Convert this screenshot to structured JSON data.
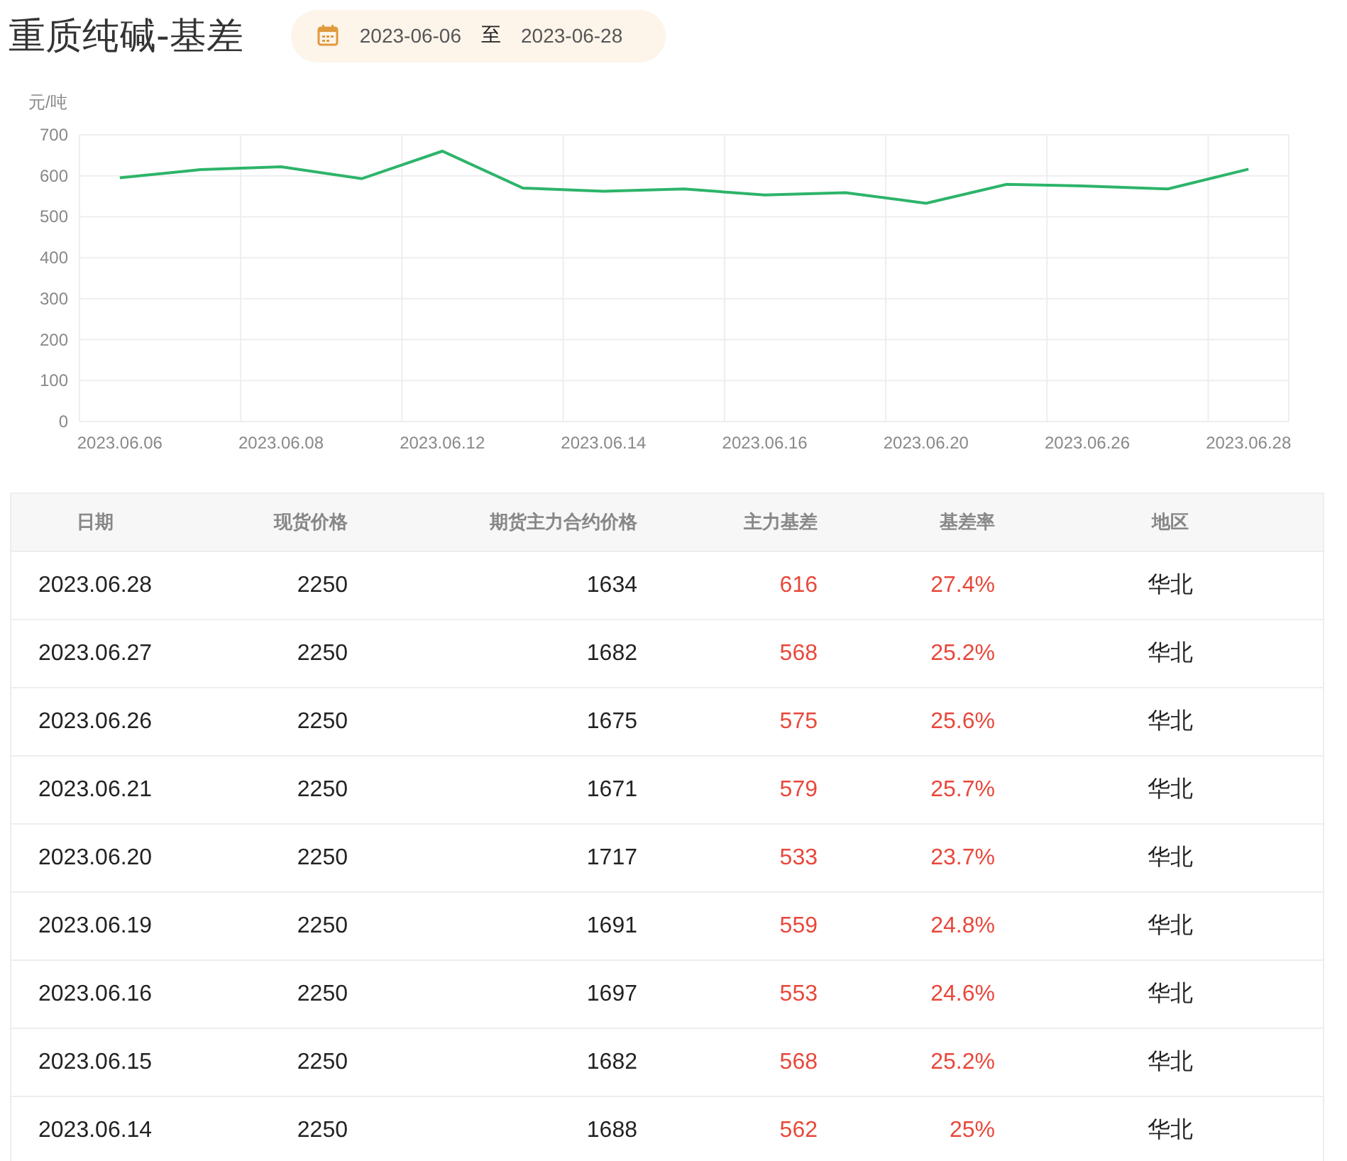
{
  "title": "重质纯碱-基差",
  "date_range": {
    "start": "2023-06-06",
    "separator": "至",
    "end": "2023-06-28"
  },
  "chart": {
    "chart_data": {
      "type": "line",
      "ylabel": "元/吨",
      "categories": [
        "2023.06.06",
        null,
        "2023.06.08",
        null,
        "2023.06.12",
        null,
        "2023.06.14",
        null,
        "2023.06.16",
        null,
        "2023.06.20",
        null,
        "2023.06.26",
        null,
        "2023.06.28"
      ],
      "grid": true,
      "series": [
        {
          "color": "#2db46a",
          "values": [
            595,
            615,
            622,
            593,
            660,
            570,
            562,
            568,
            553,
            559,
            533,
            579,
            575,
            568,
            616
          ]
        }
      ],
      "ylim": [
        0,
        700
      ],
      "yticks": [
        0,
        100,
        200,
        300,
        400,
        500,
        600,
        700
      ]
    }
  },
  "table": {
    "columns": [
      "日期",
      "现货价格",
      "期货主力合约价格",
      "主力基差",
      "基差率",
      "地区"
    ],
    "rows": [
      [
        "2023.06.28",
        "2250",
        "1634",
        "616",
        "27.4%",
        "华北"
      ],
      [
        "2023.06.27",
        "2250",
        "1682",
        "568",
        "25.2%",
        "华北"
      ],
      [
        "2023.06.26",
        "2250",
        "1675",
        "575",
        "25.6%",
        "华北"
      ],
      [
        "2023.06.21",
        "2250",
        "1671",
        "579",
        "25.7%",
        "华北"
      ],
      [
        "2023.06.20",
        "2250",
        "1717",
        "533",
        "23.7%",
        "华北"
      ],
      [
        "2023.06.19",
        "2250",
        "1691",
        "559",
        "24.8%",
        "华北"
      ],
      [
        "2023.06.16",
        "2250",
        "1697",
        "553",
        "24.6%",
        "华北"
      ],
      [
        "2023.06.15",
        "2250",
        "1682",
        "568",
        "25.2%",
        "华北"
      ],
      [
        "2023.06.14",
        "2250",
        "1688",
        "562",
        "25%",
        "华北"
      ]
    ]
  }
}
